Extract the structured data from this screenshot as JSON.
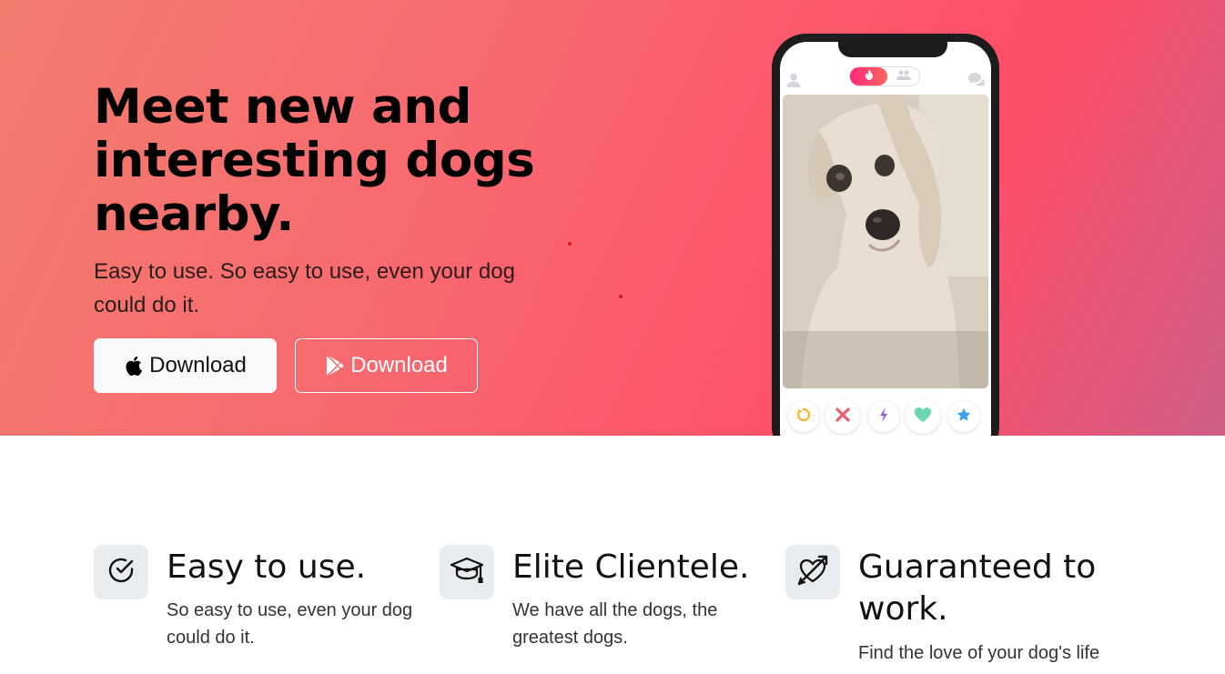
{
  "hero": {
    "title": "Meet new and interesting dogs nearby.",
    "subtitle": "Easy to use. So easy to use, even your dog could do it.",
    "apple_button_label": "Download",
    "play_button_label": "Download"
  },
  "phone": {
    "photo_subject": "dog-photo",
    "action_buttons": [
      "rewind-icon",
      "nope-icon",
      "boost-icon",
      "like-icon",
      "superlike-icon"
    ]
  },
  "features": [
    {
      "title": "Easy to use.",
      "text": "So easy to use, even your dog could do it.",
      "icon": "check-circle-icon"
    },
    {
      "title": "Elite Clientele.",
      "text": "We have all the dogs, the greatest dogs.",
      "icon": "graduation-cap-icon"
    },
    {
      "title": "Guaranteed to work.",
      "text": "Find the love of your dog's life",
      "icon": "heart-arrow-icon"
    }
  ],
  "colors": {
    "accent_gradient_start": "#f17c6e",
    "accent_gradient_end": "#fe4d68",
    "feature_icon_bg": "#e9ecef"
  }
}
